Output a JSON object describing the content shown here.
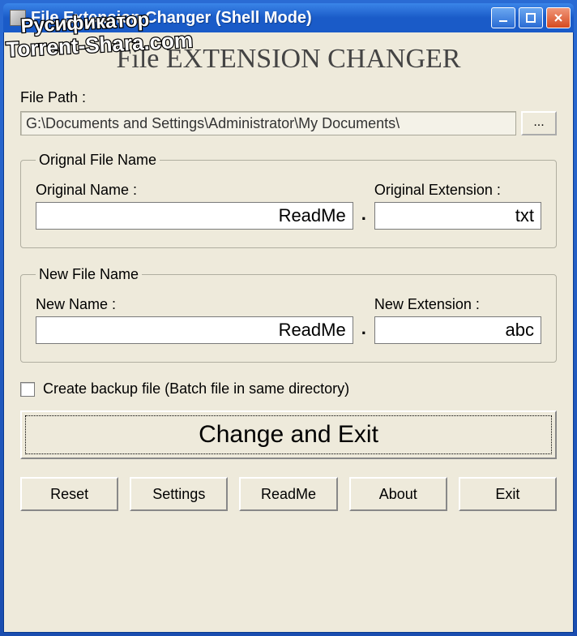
{
  "window": {
    "title": "File Extension Changer (Shell Mode)"
  },
  "header": "File EXTENSION CHANGER",
  "filePath": {
    "label": "File Path :",
    "value": "G:\\Documents and Settings\\Administrator\\My Documents\\",
    "browse": "..."
  },
  "originalGroup": {
    "legend": "Orignal File Name",
    "nameLabel": "Original Name :",
    "nameValue": "ReadMe",
    "extLabel": "Original Extension :",
    "extValue": "txt",
    "separator": "."
  },
  "newGroup": {
    "legend": "New File Name",
    "nameLabel": "New Name :",
    "nameValue": "ReadMe",
    "extLabel": "New Extension :",
    "extValue": "abc",
    "separator": "."
  },
  "backup": {
    "label": "Create backup file (Batch file in same directory)",
    "checked": false
  },
  "mainButton": "Change and Exit",
  "buttons": {
    "reset": "Reset",
    "settings": "Settings",
    "readme": "ReadMe",
    "about": "About",
    "exit": "Exit"
  },
  "watermark": {
    "line1": "Русификатор",
    "line2": "Torrent-Shara.com"
  }
}
